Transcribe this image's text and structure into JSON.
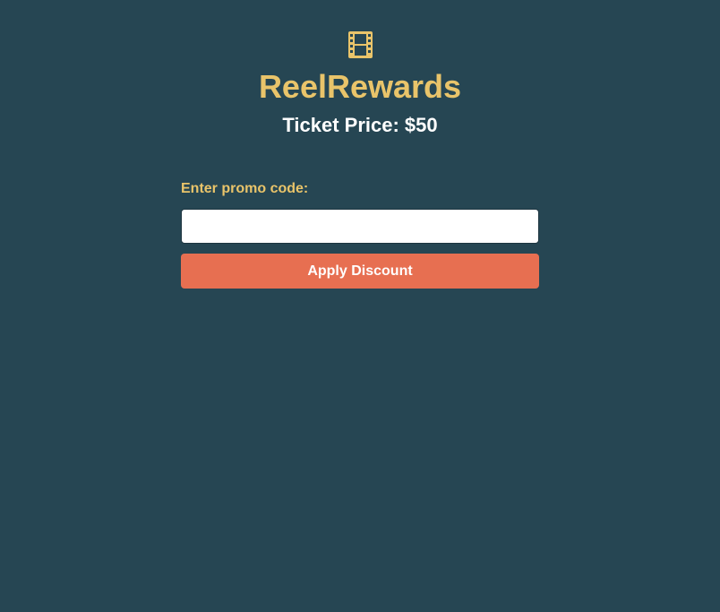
{
  "app": {
    "title": "ReelRewards",
    "logo_icon": "film-reel-icon",
    "ticket_price_text": "Ticket Price: $50"
  },
  "promo": {
    "label": "Enter promo code:",
    "value": "",
    "placeholder": "",
    "apply_button_label": "Apply Discount"
  },
  "colors": {
    "background": "#264653",
    "accent": "#e9c46a",
    "button": "#e76f51",
    "text": "#ffffff"
  }
}
